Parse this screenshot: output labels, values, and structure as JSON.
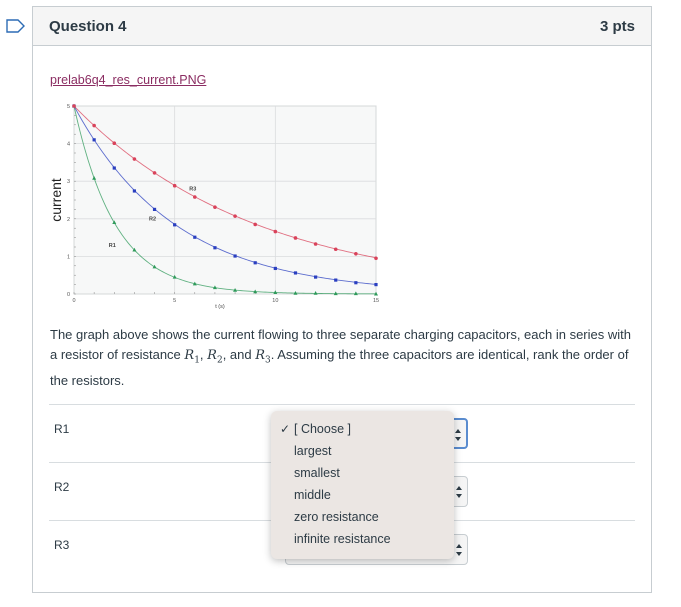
{
  "question": {
    "title": "Question 4",
    "points": "3 pts"
  },
  "attachment": {
    "filename": "prelab6q4_res_current.PNG"
  },
  "chart_data": {
    "type": "scatter",
    "ylabel": "current",
    "xlabel": "t (s)",
    "xlim": [
      0,
      15
    ],
    "ylim": [
      0,
      5
    ],
    "x_ticks": [
      "0",
      "5",
      "10",
      "15"
    ],
    "y_ticks": [
      "0",
      "1",
      "2",
      "3",
      "4",
      "5"
    ],
    "grid": true,
    "annotations": [
      "R1",
      "R2",
      "R3"
    ],
    "series": [
      {
        "name": "R1",
        "color": "#2e9a5a",
        "marker": "triangle",
        "x": [
          0,
          1,
          2,
          3,
          4,
          5,
          6,
          7,
          8,
          9,
          10,
          11,
          12,
          13,
          14,
          15
        ],
        "y": [
          5,
          3.08,
          1.9,
          1.17,
          0.72,
          0.45,
          0.27,
          0.17,
          0.1,
          0.06,
          0.04,
          0.02,
          0.02,
          0.01,
          0.01,
          0
        ]
      },
      {
        "name": "R2",
        "color": "#2a3fc0",
        "marker": "square",
        "x": [
          0,
          1,
          2,
          3,
          4,
          5,
          6,
          7,
          8,
          9,
          10,
          11,
          12,
          13,
          14,
          15
        ],
        "y": [
          5,
          4.1,
          3.35,
          2.74,
          2.25,
          1.84,
          1.51,
          1.23,
          1.01,
          0.83,
          0.68,
          0.56,
          0.45,
          0.37,
          0.3,
          0.25
        ]
      },
      {
        "name": "R3",
        "color": "#d9425a",
        "marker": "circle",
        "x": [
          0,
          1,
          2,
          3,
          4,
          5,
          6,
          7,
          8,
          9,
          10,
          11,
          12,
          13,
          14,
          15
        ],
        "y": [
          5,
          4.48,
          4.01,
          3.59,
          3.22,
          2.88,
          2.58,
          2.31,
          2.07,
          1.85,
          1.66,
          1.49,
          1.33,
          1.19,
          1.07,
          0.95
        ]
      }
    ]
  },
  "description": {
    "part1": "The graph above shows the current flowing to three separate charging capacitors, each in series with a resistor of resistance ",
    "r1": "R",
    "r1_sub": "1",
    "sep1": ", ",
    "r2": "R",
    "r2_sub": "2",
    "sep2": ", and ",
    "r3": "R",
    "r3_sub": "3",
    "part2": ". Assuming the three capacitors are identical, rank the order of the resistors."
  },
  "rows": [
    {
      "label": "R1",
      "selected": ""
    },
    {
      "label": "R2",
      "selected": ""
    },
    {
      "label": "R3",
      "selected": ""
    }
  ],
  "dropdown": {
    "checkmark": "✓",
    "options": [
      "[ Choose ]",
      "largest",
      "smallest",
      "middle",
      "zero resistance",
      "infinite resistance"
    ]
  }
}
